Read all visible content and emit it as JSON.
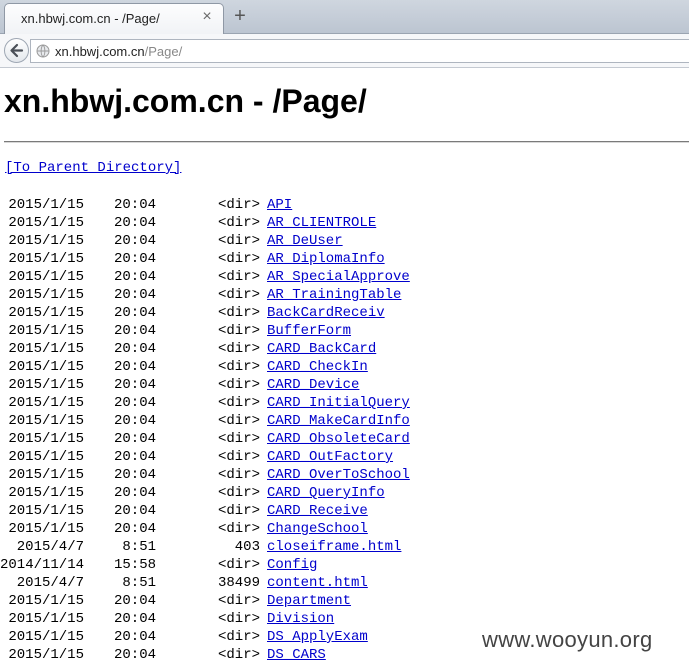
{
  "browser": {
    "tab_title": "xn.hbwj.com.cn - /Page/",
    "tab_close_icon": "close-icon",
    "new_tab_icon": "plus-icon",
    "back_icon": "back-arrow-icon",
    "site_icon": "globe-icon",
    "url_domain": "xn.hbwj.com.cn",
    "url_path": "/Page/"
  },
  "page": {
    "heading": "xn.hbwj.com.cn - /Page/",
    "parent_link": "[To Parent Directory]",
    "entries": [
      {
        "date": "2015/1/15",
        "time": "20:04",
        "size": "<dir>",
        "name": "API"
      },
      {
        "date": "2015/1/15",
        "time": "20:04",
        "size": "<dir>",
        "name": "AR_CLIENTROLE"
      },
      {
        "date": "2015/1/15",
        "time": "20:04",
        "size": "<dir>",
        "name": "AR_DeUser"
      },
      {
        "date": "2015/1/15",
        "time": "20:04",
        "size": "<dir>",
        "name": "AR_DiplomaInfo"
      },
      {
        "date": "2015/1/15",
        "time": "20:04",
        "size": "<dir>",
        "name": "AR_SpecialApprove"
      },
      {
        "date": "2015/1/15",
        "time": "20:04",
        "size": "<dir>",
        "name": "AR_TrainingTable"
      },
      {
        "date": "2015/1/15",
        "time": "20:04",
        "size": "<dir>",
        "name": "BackCardReceiv"
      },
      {
        "date": "2015/1/15",
        "time": "20:04",
        "size": "<dir>",
        "name": "BufferForm"
      },
      {
        "date": "2015/1/15",
        "time": "20:04",
        "size": "<dir>",
        "name": "CARD_BackCard"
      },
      {
        "date": "2015/1/15",
        "time": "20:04",
        "size": "<dir>",
        "name": "CARD_CheckIn"
      },
      {
        "date": "2015/1/15",
        "time": "20:04",
        "size": "<dir>",
        "name": "CARD_Device"
      },
      {
        "date": "2015/1/15",
        "time": "20:04",
        "size": "<dir>",
        "name": "CARD_InitialQuery"
      },
      {
        "date": "2015/1/15",
        "time": "20:04",
        "size": "<dir>",
        "name": "CARD_MakeCardInfo"
      },
      {
        "date": "2015/1/15",
        "time": "20:04",
        "size": "<dir>",
        "name": "CARD_ObsoleteCard"
      },
      {
        "date": "2015/1/15",
        "time": "20:04",
        "size": "<dir>",
        "name": "CARD_OutFactory"
      },
      {
        "date": "2015/1/15",
        "time": "20:04",
        "size": "<dir>",
        "name": "CARD_OverToSchool"
      },
      {
        "date": "2015/1/15",
        "time": "20:04",
        "size": "<dir>",
        "name": "CARD_QueryInfo"
      },
      {
        "date": "2015/1/15",
        "time": "20:04",
        "size": "<dir>",
        "name": "CARD_Receive"
      },
      {
        "date": "2015/1/15",
        "time": "20:04",
        "size": "<dir>",
        "name": "ChangeSchool"
      },
      {
        "date": "2015/4/7",
        "time": "8:51",
        "size": "403",
        "name": "closeiframe.html"
      },
      {
        "date": "2014/11/14",
        "time": "15:58",
        "size": "<dir>",
        "name": "Config"
      },
      {
        "date": "2015/4/7",
        "time": "8:51",
        "size": "38499",
        "name": "content.html"
      },
      {
        "date": "2015/1/15",
        "time": "20:04",
        "size": "<dir>",
        "name": "Department"
      },
      {
        "date": "2015/1/15",
        "time": "20:04",
        "size": "<dir>",
        "name": "Division"
      },
      {
        "date": "2015/1/15",
        "time": "20:04",
        "size": "<dir>",
        "name": "DS_ApplyExam"
      },
      {
        "date": "2015/1/15",
        "time": "20:04",
        "size": "<dir>",
        "name": "DS_CARS"
      }
    ]
  },
  "watermark": "www.wooyun.org",
  "colors": {
    "link": "#0000cc",
    "tab_bar": "#c6cdd7",
    "heading": "#000000"
  }
}
